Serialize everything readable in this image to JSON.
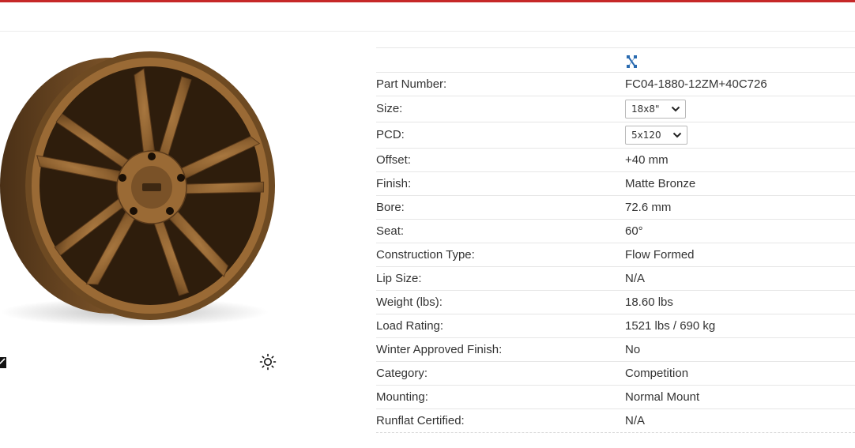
{
  "colors": {
    "accent": "#c62828",
    "wheel": "#8a5e2e",
    "logo": "#2a6bb0"
  },
  "product_image": {
    "alt": "Bronze 5-split-spoke alloy wheel"
  },
  "icons": {
    "edit": "edit-icon",
    "light": "sun-icon",
    "logo": "brand-logo-icon",
    "dropdown": "chevron-down-icon"
  },
  "specs": {
    "part_number": {
      "label": "Part Number:",
      "value": "FC04-1880-12ZM+40C726"
    },
    "size": {
      "label": "Size:",
      "selected": "18x8\""
    },
    "pcd": {
      "label": "PCD:",
      "selected": "5x120"
    },
    "offset": {
      "label": "Offset:",
      "value": "+40 mm"
    },
    "finish": {
      "label": "Finish:",
      "value": "Matte Bronze"
    },
    "bore": {
      "label": "Bore:",
      "value": "72.6 mm"
    },
    "seat": {
      "label": "Seat:",
      "value": "60°"
    },
    "construction": {
      "label": "Construction Type:",
      "value": "Flow Formed"
    },
    "lip": {
      "label": "Lip Size:",
      "value": "N/A"
    },
    "weight": {
      "label": "Weight (lbs):",
      "value": "18.60 lbs"
    },
    "load": {
      "label": "Load Rating:",
      "value": "1521 lbs / 690 kg"
    },
    "winter": {
      "label": "Winter Approved Finish:",
      "value": "No"
    },
    "category": {
      "label": "Category:",
      "value": "Competition"
    },
    "mounting": {
      "label": "Mounting:",
      "value": "Normal Mount"
    },
    "runflat": {
      "label": "Runflat Certified:",
      "value": "N/A"
    }
  }
}
